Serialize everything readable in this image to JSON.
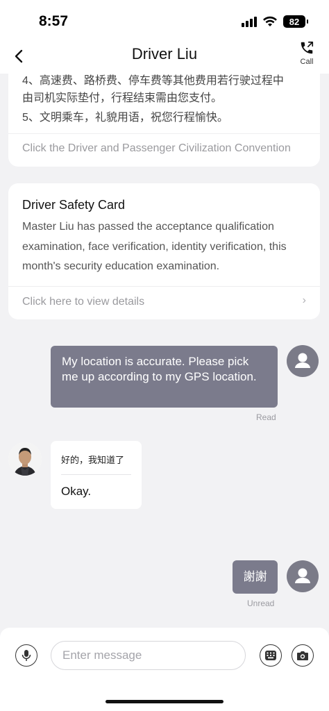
{
  "status_bar": {
    "time": "8:57",
    "battery": "82"
  },
  "nav": {
    "title": "Driver Liu",
    "call_label": "Call"
  },
  "rules_card": {
    "lines": [
      "4、高速费、路桥费、停车费等其他费用若行驶过程中",
      "由司机实际垫付，行程结束需由您支付。",
      "5、文明乘车，礼貌用语，祝您行程愉快。"
    ],
    "link_text": "Click the Driver and Passenger Civilization Convention"
  },
  "safety_card": {
    "title": "Driver Safety Card",
    "body": "Master Liu has passed the acceptance qualification examination, face verification, identity verification, this month's security education examination.",
    "link_text": "Click here to view details"
  },
  "messages": [
    {
      "sender": "me",
      "text": "My location is accurate. Please pick me up according to my GPS location.",
      "status": "Read"
    },
    {
      "sender": "driver",
      "original": "好的，我知道了",
      "translation": "Okay."
    },
    {
      "sender": "me",
      "text": "謝謝",
      "status": "Unread"
    }
  ],
  "input": {
    "placeholder": "Enter message"
  },
  "colors": {
    "outgoing_bubble": "#7b7b8c",
    "background": "#f2f2f4",
    "card": "#ffffff"
  },
  "icons": {
    "back": "chevron-left-icon",
    "call": "phone-icon",
    "user_avatar": "person-icon",
    "voice": "microphone-icon",
    "keyboard": "keypad-icon",
    "camera": "camera-icon"
  }
}
